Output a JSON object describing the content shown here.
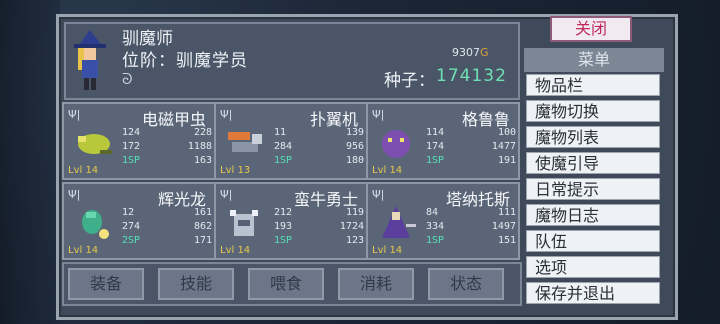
{
  "header": {
    "title": "驯魔师",
    "rank": "位阶：驯魔学员",
    "gold_value": "9307",
    "gold_unit": "G",
    "seed_label": "种子：",
    "seed_value": "174132",
    "swirl": "ᘐ"
  },
  "monsters": [
    {
      "name": "电磁甲虫",
      "s1": "124",
      "s2": "228",
      "s3": "172",
      "s4": "1188",
      "sp": "1SP",
      "s6": "163",
      "lv": "Lvl 14"
    },
    {
      "name": "扑翼机",
      "s1": "11",
      "s2": "139",
      "s3": "284",
      "s4": "956",
      "sp": "1SP",
      "s6": "180",
      "lv": "Lvl 13"
    },
    {
      "name": "格鲁鲁",
      "s1": "114",
      "s2": "100",
      "s3": "174",
      "s4": "1477",
      "sp": "1SP",
      "s6": "191",
      "lv": "Lvl 14"
    },
    {
      "name": "辉光龙",
      "s1": "12",
      "s2": "161",
      "s3": "274",
      "s4": "862",
      "sp": "2SP",
      "s6": "171",
      "lv": "Lvl 14"
    },
    {
      "name": "蛮牛勇士",
      "s1": "212",
      "s2": "119",
      "s3": "193",
      "s4": "1724",
      "sp": "1SP",
      "s6": "123",
      "lv": "Lvl 14"
    },
    {
      "name": "塔纳托斯",
      "s1": "84",
      "s2": "111",
      "s3": "334",
      "s4": "1497",
      "sp": "1SP",
      "s6": "151",
      "lv": "Lvl 14"
    }
  ],
  "bottom_buttons": [
    "装备",
    "技能",
    "喂食",
    "消耗",
    "状态"
  ],
  "close_label": "关闭",
  "menu": {
    "title": "菜单",
    "items": [
      "物品栏",
      "魔物切换",
      "魔物列表",
      "使魔引导",
      "日常提示",
      "魔物日志",
      "队伍",
      "选项",
      "保存并退出"
    ]
  },
  "colors": {
    "seed": "#6fe0b2",
    "sp": "#55e0b6",
    "close_text": "#c02a5a",
    "gold_unit": "#e0a23a"
  }
}
